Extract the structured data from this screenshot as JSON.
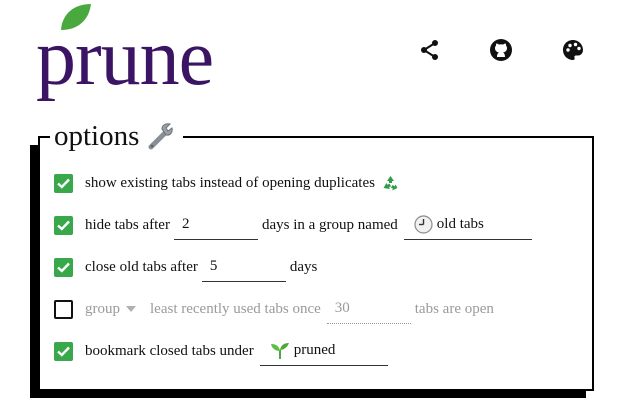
{
  "header": {
    "logo_text": "prune",
    "brand_color": "#3b1563",
    "leaf_color": "#49a83e",
    "icons": [
      "share-icon",
      "github-icon",
      "palette-icon"
    ]
  },
  "options": {
    "title": "options",
    "title_icon": "wrench-icon",
    "checked_color": "#38a84a",
    "rows": [
      {
        "checked": true,
        "label": "show existing tabs instead of opening duplicates",
        "icon": "recycle-icon"
      },
      {
        "checked": true,
        "label_before": "hide tabs after",
        "days_value": "2",
        "label_middle": "days in a group named",
        "group_name_icon": "clock-icon",
        "group_name": "old tabs"
      },
      {
        "checked": true,
        "label_before": "close old tabs after",
        "days_value": "5",
        "label_after": "days"
      },
      {
        "checked": false,
        "select_value": "group",
        "label_middle": "least recently used tabs once",
        "count_value": "30",
        "label_after": "tabs are open"
      },
      {
        "checked": true,
        "label_before": "bookmark closed tabs under",
        "folder_icon": "seedling-icon",
        "folder_name": "pruned"
      }
    ]
  }
}
